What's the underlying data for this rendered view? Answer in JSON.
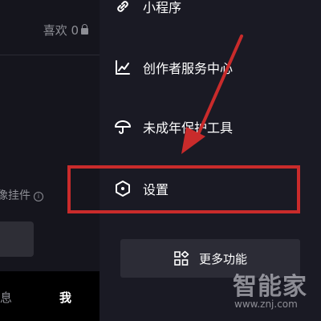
{
  "left_page": {
    "likes_label": "喜欢 0",
    "pendant_label": "像挂件",
    "tabbar": {
      "messages_label": "息",
      "me_label": "我"
    }
  },
  "drawer": {
    "items": [
      {
        "label": "小程序",
        "icon": "mini-program-link-icon"
      },
      {
        "label": "创作者服务中心",
        "icon": "chart-line-icon"
      },
      {
        "label": "未成年保护工具",
        "icon": "umbrella-icon"
      },
      {
        "label": "设置",
        "icon": "settings-hexagon-icon"
      }
    ],
    "more_button": {
      "label": "更多功能",
      "icon": "grid-apps-icon"
    }
  },
  "annotation": {
    "highlight_color": "#c92b2b",
    "arrow_color": "#c92b2b",
    "highlighted_item": "设置"
  },
  "watermark": {
    "logo_text": "智能家",
    "url_text": "www.znj.com"
  },
  "colors": {
    "background": "#16161f",
    "drawer_background": "#1a1a24",
    "muted_text": "#8d8e95",
    "button_background": "#2c2c36"
  }
}
